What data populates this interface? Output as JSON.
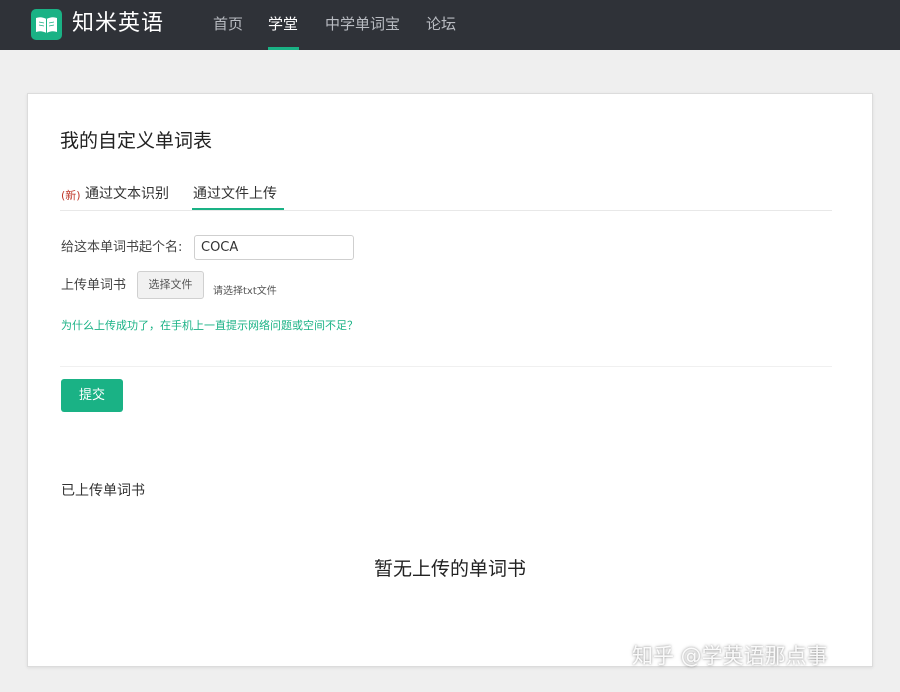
{
  "header": {
    "brand": "知米英语",
    "nav": [
      {
        "label": "首页"
      },
      {
        "label": "学堂"
      },
      {
        "label": "中学单词宝"
      },
      {
        "label": "论坛"
      }
    ]
  },
  "colors": {
    "accent": "#1ab285",
    "topbar": "#2f3238",
    "new_badge": "#c0392b"
  },
  "card": {
    "title": "我的自定义单词表",
    "tabs": {
      "new_badge": "(新)",
      "items": [
        {
          "label": "通过文本识别"
        },
        {
          "label": "通过文件上传"
        }
      ]
    },
    "form": {
      "name_label": "给这本单词书起个名:",
      "name_value": "COCA",
      "upload_label": "上传单词书",
      "choose_file_label": "选择文件",
      "file_hint": "请选择txt文件",
      "help_link": "为什么上传成功了，在手机上一直提示网络问题或空间不足？",
      "submit_label": "提交"
    },
    "uploaded": {
      "section_title": "已上传单词书",
      "empty_text": "暂无上传的单词书"
    }
  },
  "watermark": "知乎 @学英语那点事"
}
